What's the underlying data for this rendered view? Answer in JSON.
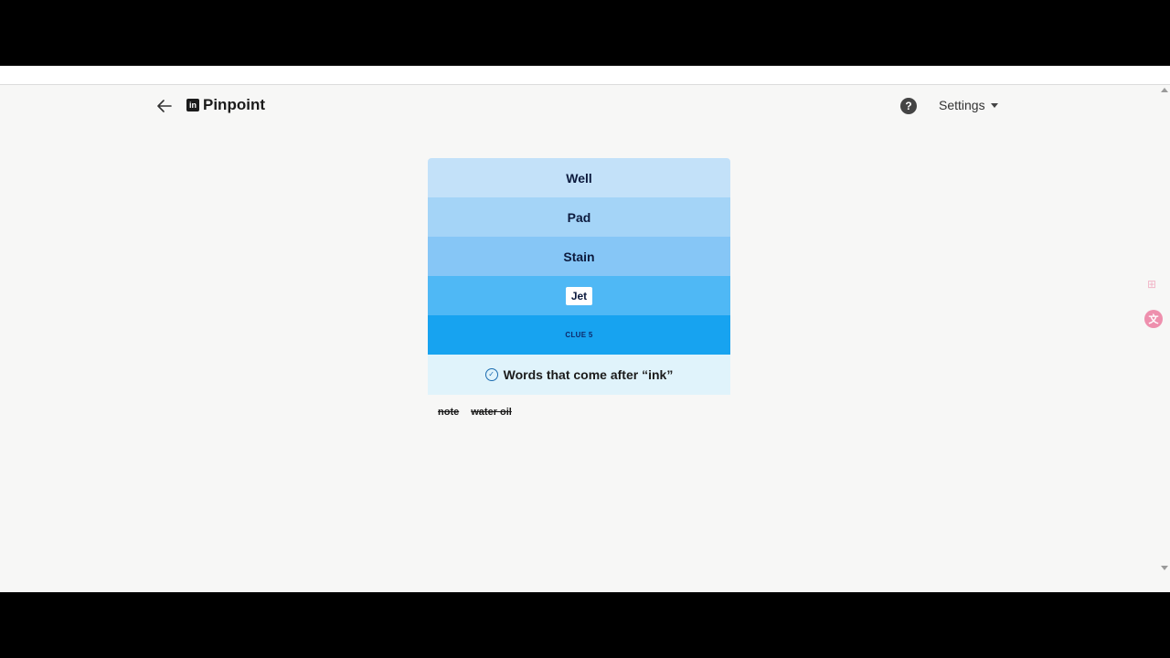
{
  "header": {
    "back_icon": "arrow-left-icon",
    "logo_icon": "linkedin-logo-icon",
    "logo_letters": "in",
    "title": "Pinpoint",
    "help_icon": "question-circle-icon",
    "help_glyph": "?",
    "settings_label": "Settings",
    "settings_icon": "caret-down-icon"
  },
  "game": {
    "clues": [
      "Well",
      "Pad",
      "Stain",
      "Jet",
      "CLUE 5"
    ],
    "clue_colors": [
      "#c3e1f9",
      "#a4d4f7",
      "#86c6f6",
      "#4fb8f5",
      "#17a3f0"
    ],
    "answer": "Words that come after “ink”",
    "answer_icon": "check-circle-icon",
    "previous_guesses": [
      "note",
      "water oil"
    ]
  },
  "side_toolbar": {
    "icons": [
      "apps-icon",
      "translate-icon"
    ]
  }
}
